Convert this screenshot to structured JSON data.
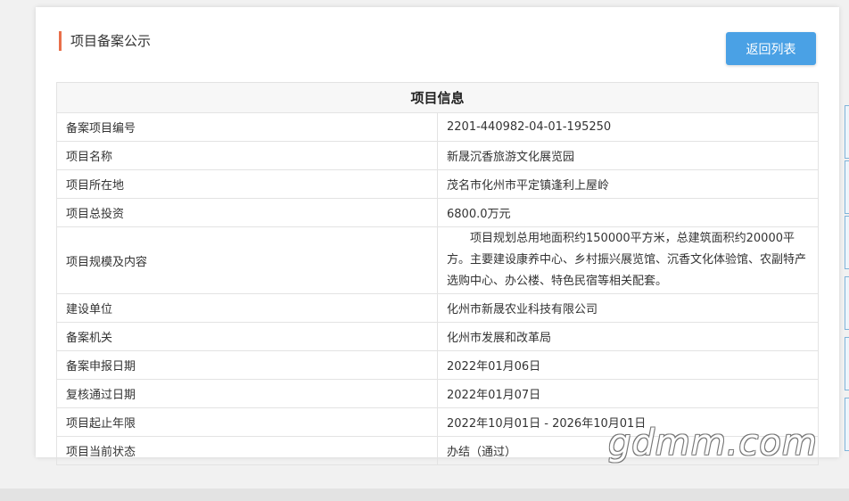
{
  "page": {
    "heading": "项目备案公示",
    "back_button": "返回列表",
    "table_caption": "项目信息",
    "watermark": "gdmm.com"
  },
  "rows": [
    {
      "label": "备案项目编号",
      "value": "2201-440982-04-01-195250"
    },
    {
      "label": "项目名称",
      "value": "新晟沉香旅游文化展览园"
    },
    {
      "label": "项目所在地",
      "value": "茂名市化州市平定镇逢利上屋岭"
    },
    {
      "label": "项目总投资",
      "value": "6800.0万元"
    },
    {
      "label": "项目规模及内容",
      "value": "项目规划总用地面积约150000平方米，总建筑面积约20000平方。主要建设康养中心、乡村振兴展览馆、沉香文化体验馆、农副特产选购中心、办公楼、特色民宿等相关配套。"
    },
    {
      "label": "建设单位",
      "value": "化州市新晟农业科技有限公司"
    },
    {
      "label": "备案机关",
      "value": "化州市发展和改革局"
    },
    {
      "label": "备案申报日期",
      "value": "2022年01月06日"
    },
    {
      "label": "复核通过日期",
      "value": "2022年01月07日"
    },
    {
      "label": "项目起止年限",
      "value": "2022年10月01日 - 2026年10月01日"
    },
    {
      "label": "项目当前状态",
      "value": "办结（通过）"
    }
  ],
  "colors": {
    "accent_bar": "#e96f4a",
    "button": "#4aa1e5"
  }
}
